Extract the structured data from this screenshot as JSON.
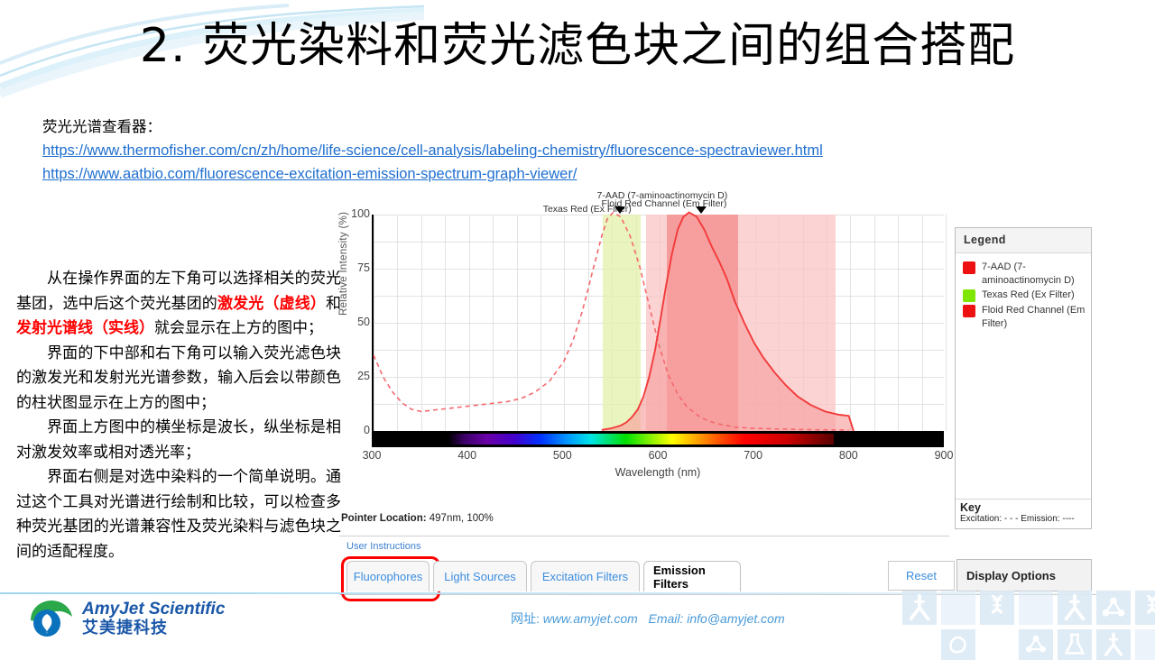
{
  "slide": {
    "title": "2. 荧光染料和荧光滤色块之间的组合搭配",
    "links_heading": "荧光光谱查看器：",
    "links": [
      "https://www.thermofisher.com/cn/zh/home/life-science/cell-analysis/labeling-chemistry/fluorescence-spectraviewer.html",
      "https://www.aatbio.com/fluorescence-excitation-emission-spectrum-graph-viewer/"
    ],
    "body_paragraphs": [
      {
        "pre": "从在操作界面的左下角可以选择相关的荧光基团，选中后这个荧光基团的",
        "hl1": "激发光（虚线）",
        "mid": "和",
        "hl2": "发射光谱线（实线）",
        "post": "就会显示在上方的图中；"
      },
      {
        "pre": "界面的下中部和右下角可以输入荧光滤色块的激发光和发射光光谱参数，输入后会以带颜色的柱状图显示在上方的图中；",
        "hl1": "",
        "mid": "",
        "hl2": "",
        "post": ""
      },
      {
        "pre": "界面上方图中的横坐标是波长，纵坐标是相对激发效率或相对透光率；",
        "hl1": "",
        "mid": "",
        "hl2": "",
        "post": ""
      },
      {
        "pre": "界面右侧是对选中染料的一个简单说明。通过这个工具对光谱进行绘制和比较，可以检查多种荧光基团的光谱兼容性及荧光染料与滤色块之间的适配程度。",
        "hl1": "",
        "mid": "",
        "hl2": "",
        "post": ""
      }
    ]
  },
  "chart_data": {
    "type": "line",
    "title": "",
    "xlabel": "Wavelength (nm)",
    "ylabel": "Relative Intensity (%)",
    "xlim": [
      300,
      900
    ],
    "ylim": [
      0,
      100
    ],
    "xticks": [
      300,
      400,
      500,
      600,
      700,
      800,
      900
    ],
    "yticks": [
      0,
      25,
      50,
      75,
      100
    ],
    "grid": true,
    "legend_position": "right-panel",
    "series": [
      {
        "name": "7-AAD Excitation",
        "style": "dashed",
        "color": "#f4696e",
        "x": [
          300,
          310,
          320,
          330,
          340,
          350,
          360,
          380,
          400,
          420,
          440,
          455,
          470,
          485,
          500,
          510,
          520,
          530,
          540,
          546,
          552,
          560,
          570,
          580,
          590,
          600,
          610,
          620,
          630,
          645,
          660,
          680,
          700,
          760,
          800
        ],
        "y": [
          35,
          25,
          18,
          13,
          10,
          9,
          9.5,
          10.5,
          11.5,
          12.5,
          13.5,
          15,
          18,
          23,
          32,
          42,
          56,
          73,
          90,
          98,
          101,
          99,
          90,
          76,
          58,
          40,
          26,
          17,
          11,
          6,
          3.5,
          1.8,
          1.2,
          0.6,
          0.4
        ]
      },
      {
        "name": "7-AAD Emission",
        "style": "solid",
        "color": "#f23b3b",
        "fill": "#f7a0a0",
        "x": [
          540,
          550,
          560,
          566,
          572,
          578,
          584,
          590,
          596,
          602,
          608,
          614,
          620,
          626,
          632,
          640,
          648,
          656,
          664,
          672,
          680,
          690,
          700,
          710,
          722,
          734,
          746,
          760,
          775,
          790,
          800,
          805
        ],
        "y": [
          0.5,
          1.2,
          2.5,
          4,
          6.5,
          10,
          16,
          25,
          37,
          52,
          68,
          82,
          93,
          99,
          101,
          99,
          93,
          85,
          78,
          70,
          60,
          50,
          41,
          34,
          27,
          21,
          16,
          12,
          9,
          7.5,
          7,
          0
        ]
      }
    ],
    "bands": [
      {
        "label": "Texas Red (Ex Filter)",
        "color": "#e3f0a8",
        "from": 540,
        "to": 580,
        "center": 560,
        "opacity": 0.75
      },
      {
        "label": "Floid Red Channel (Em Filter) outer",
        "color": "#f9c4c4",
        "from": 586,
        "to": 785,
        "center": 685,
        "opacity": 0.75
      },
      {
        "label": "Floid Red Channel (Em Filter) inner",
        "color": "#f2908f",
        "from": 608,
        "to": 682,
        "center": 645,
        "opacity": 0.8
      }
    ],
    "annotations": [
      {
        "text": "Texas Red (Ex Filter)",
        "at_nm": 560,
        "line": 1
      },
      {
        "text": "7-AAD (7-aminoactinomycin D)",
        "at_nm": 645,
        "line": 1
      },
      {
        "text": "Floid Red Channel (Em Filter)",
        "at_nm": 645,
        "line": 2
      }
    ],
    "markers": [
      {
        "at_nm": 560
      },
      {
        "at_nm": 645
      }
    ]
  },
  "viewer": {
    "pointer_label": "Pointer Location:",
    "pointer_value": "497nm, 100%",
    "instructions_link": "User Instructions",
    "legend": {
      "title": "Legend",
      "items": [
        {
          "label": "7-AAD (7-aminoactinomycin D)",
          "color": "#ee1111"
        },
        {
          "label": "Texas Red (Ex Filter)",
          "color": "#7ee600"
        },
        {
          "label": "Floid Red Channel (Em Filter)",
          "color": "#ee1111"
        }
      ],
      "key_title": "Key",
      "key_line": "Excitation: - - -   Emission: ----"
    },
    "tabs": [
      {
        "label": "Fluorophores",
        "active": false,
        "highlighted": true
      },
      {
        "label": "Light Sources",
        "active": false,
        "highlighted": false
      },
      {
        "label": "Excitation Filters",
        "active": false,
        "highlighted": false
      },
      {
        "label": "Emission Filters",
        "active": true,
        "highlighted": false
      }
    ],
    "reset_label": "Reset",
    "display_options_label": "Display Options"
  },
  "footer": {
    "brand_en": "AmyJet Scientific",
    "brand_cn": "艾美捷科技",
    "contact_cn": "网址:",
    "contact_web": " www.amyjet.com",
    "contact_email": "Email: info@amyjet.com"
  },
  "colors": {
    "title_black": "#000000",
    "link_blue": "#1f6fd0",
    "highlight_red": "#ff0000",
    "brand_blue": "#1a57a8",
    "tab_blue": "#3c8dde"
  }
}
